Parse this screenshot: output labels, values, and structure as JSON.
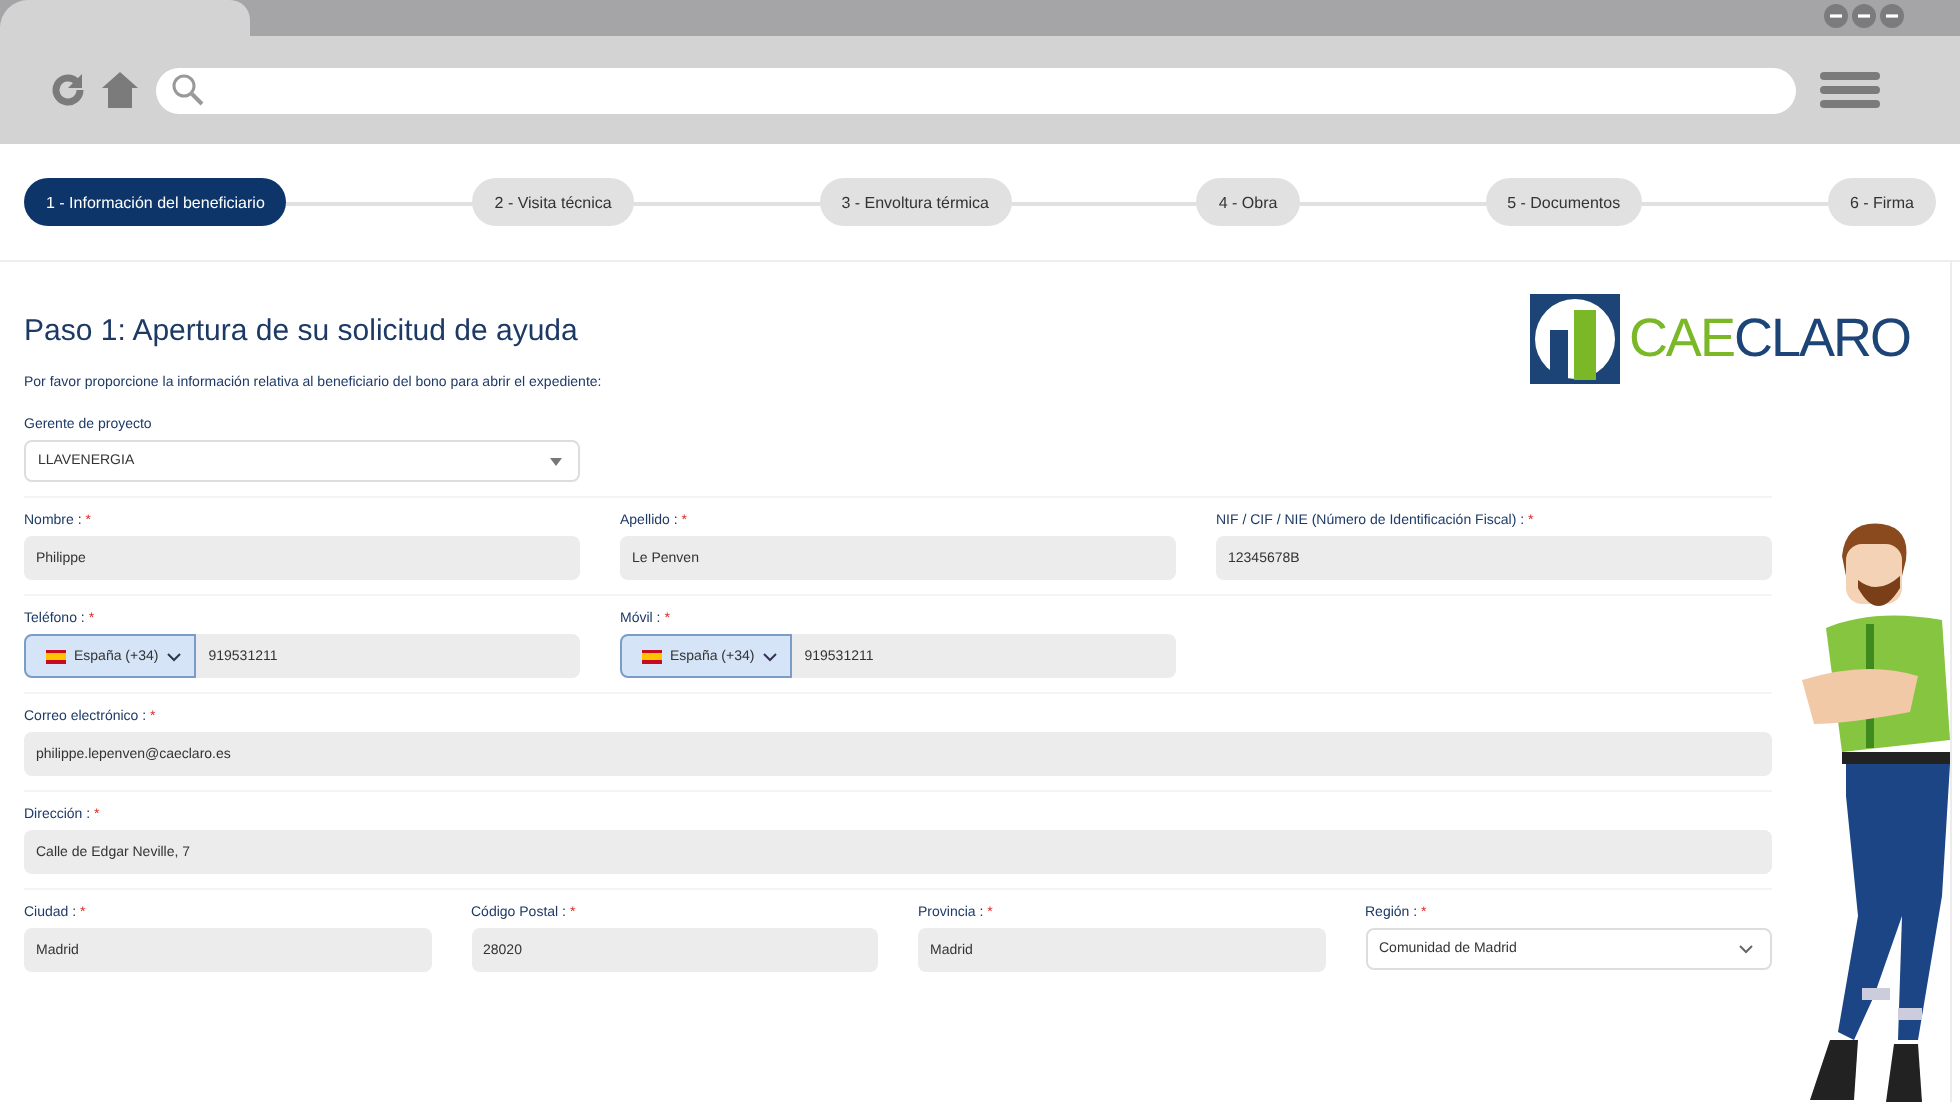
{
  "steps": [
    {
      "label": "1 - Información del beneficiario",
      "selected": true
    },
    {
      "label": "2 - Visita técnica",
      "selected": false
    },
    {
      "label": "3 - Envoltura térmica",
      "selected": false
    },
    {
      "label": "4 - Obra",
      "selected": false
    },
    {
      "label": "5 - Documentos",
      "selected": false
    },
    {
      "label": "6 - Firma",
      "selected": false
    }
  ],
  "form": {
    "title": "Paso 1: Apertura de su solicitud de ayuda",
    "intro": "Por favor proporcione la información relativa al beneficiario del bono para abrir el expediente:",
    "logo": [
      {
        "text": "CAE",
        "color": "#7ab828"
      },
      {
        "text": "CLARO",
        "color": "#1d4476"
      }
    ],
    "rows": [
      {
        "fields": [
          {
            "kind": "select",
            "label": "Gerente de proyecto",
            "value": "LLAVENERGIA"
          }
        ]
      },
      {
        "fields": [
          {
            "kind": "text",
            "label": "Nombre :",
            "required_mark": "*",
            "value": "Philippe"
          },
          {
            "kind": "text",
            "label": "Apellido :",
            "required_mark": "*",
            "value": "Le Penven"
          },
          {
            "kind": "text",
            "label": "NIF / CIF / NIE (Número de Identificación Fiscal) :",
            "required_mark": "*",
            "value": "12345678B"
          }
        ]
      },
      {
        "fields": [
          {
            "kind": "phone",
            "label": "Teléfono :",
            "required_mark": "*",
            "country": "España (+34)",
            "value": "919531211"
          },
          {
            "kind": "phone",
            "label": "Móvil :",
            "required_mark": "*",
            "country": "España (+34)",
            "value": "919531211"
          }
        ]
      },
      {
        "fields": [
          {
            "kind": "text",
            "label": "Correo electrónico :",
            "required_mark": "*",
            "value": "philippe.lepenven@caeclaro.es"
          }
        ]
      },
      {
        "fields": [
          {
            "kind": "text",
            "label": "Dirección :",
            "required_mark": "*",
            "value": "Calle de Edgar Neville, 7"
          }
        ]
      },
      {
        "fields": [
          {
            "kind": "text",
            "label": "Ciudad :",
            "required_mark": "*",
            "value": "Madrid"
          },
          {
            "kind": "text",
            "label": "Código Postal :",
            "required_mark": "*",
            "value": "28020"
          },
          {
            "kind": "text",
            "label": "Provincia :",
            "required_mark": "*",
            "value": "Madrid"
          },
          {
            "kind": "dropdown",
            "label": "Región :",
            "required_mark": "*",
            "value": "Comunidad de Madrid"
          }
        ]
      }
    ]
  }
}
